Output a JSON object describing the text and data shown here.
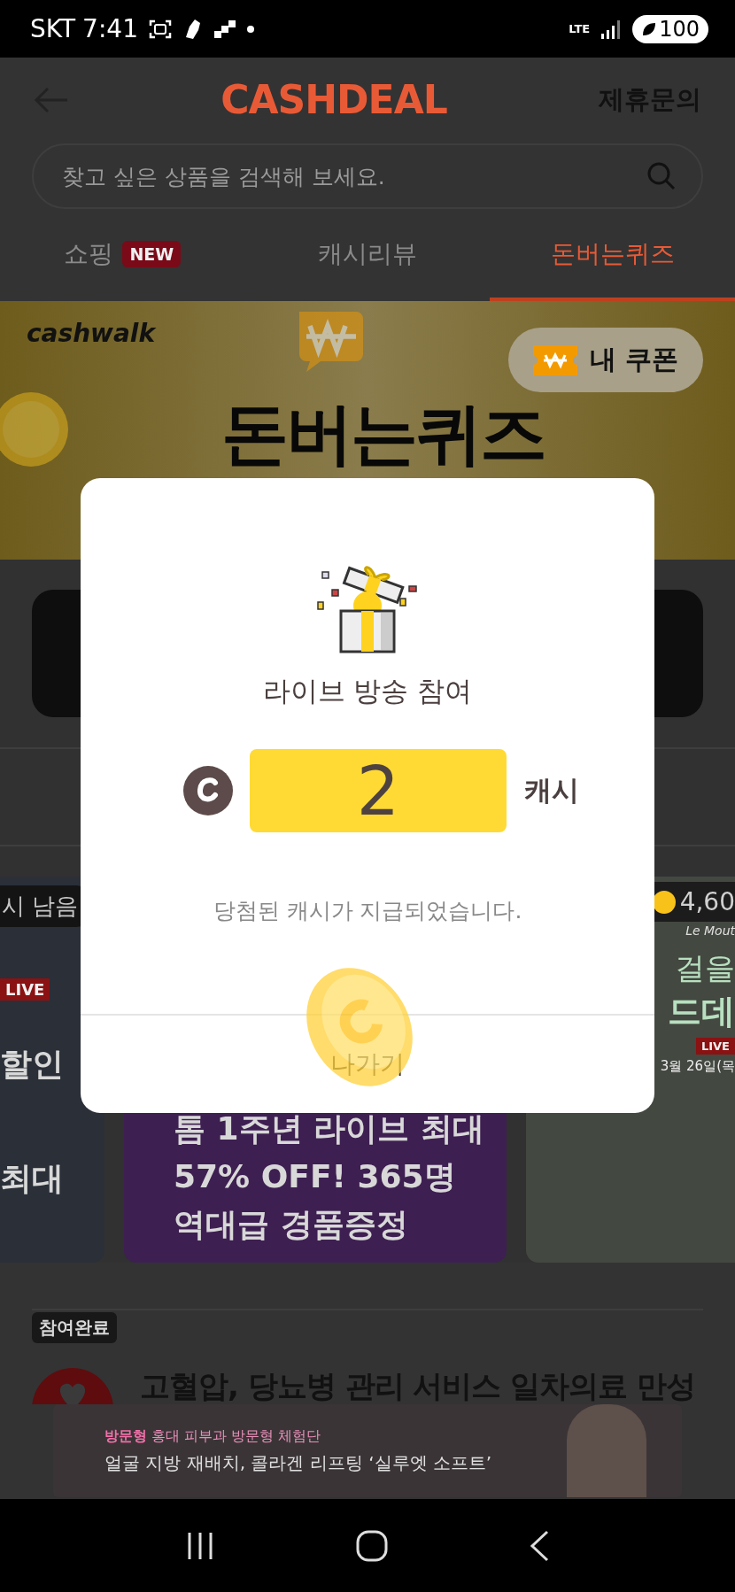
{
  "status_bar": {
    "carrier": "SKT",
    "time": "7:41",
    "network": "LTE",
    "battery": "100"
  },
  "header": {
    "title": "CASHDEAL",
    "action": "제휴문의"
  },
  "search": {
    "placeholder": "찾고 싶은 상품을 검색해 보세요."
  },
  "tabs": [
    {
      "label": "쇼핑",
      "badge": "NEW",
      "selected": false
    },
    {
      "label": "캐시리뷰",
      "selected": false
    },
    {
      "label": "돈버는퀴즈",
      "selected": true
    }
  ],
  "banner": {
    "brand": "cashwalk",
    "title": "돈버는퀴즈",
    "coupon_button": "내 쿠폰"
  },
  "live_cards": [
    {
      "time_left": "시 남음",
      "live_badge": "LIVE",
      "lines": [
        "할인",
        "최대"
      ]
    },
    {
      "lines": [
        "톰 1주년 라이브 최대",
        "57% OFF! 365명",
        "역대급 경품증정"
      ]
    },
    {
      "points": "4,60",
      "brand": "Le Mout",
      "lines": [
        "걸을",
        "드데"
      ],
      "live_badge": "LIVE",
      "date": "3월 26일(목"
    }
  ],
  "article": {
    "status_badge": "참여완료",
    "title": "고혈압, 당뇨병 관리 서비스 일차의료 만성"
  },
  "ad": {
    "tag": "방문형",
    "subtitle": "홍대 피부과 방문형 체험단",
    "headline": "얼굴 지방 재배치, 콜라겐 리프팅 ‘실루엣 소프트’"
  },
  "dialog": {
    "title": "라이브 방송 참여",
    "amount": "2",
    "unit": "캐시",
    "message": "당첨된 캐시가 지급되었습니다.",
    "button": "나가기"
  }
}
